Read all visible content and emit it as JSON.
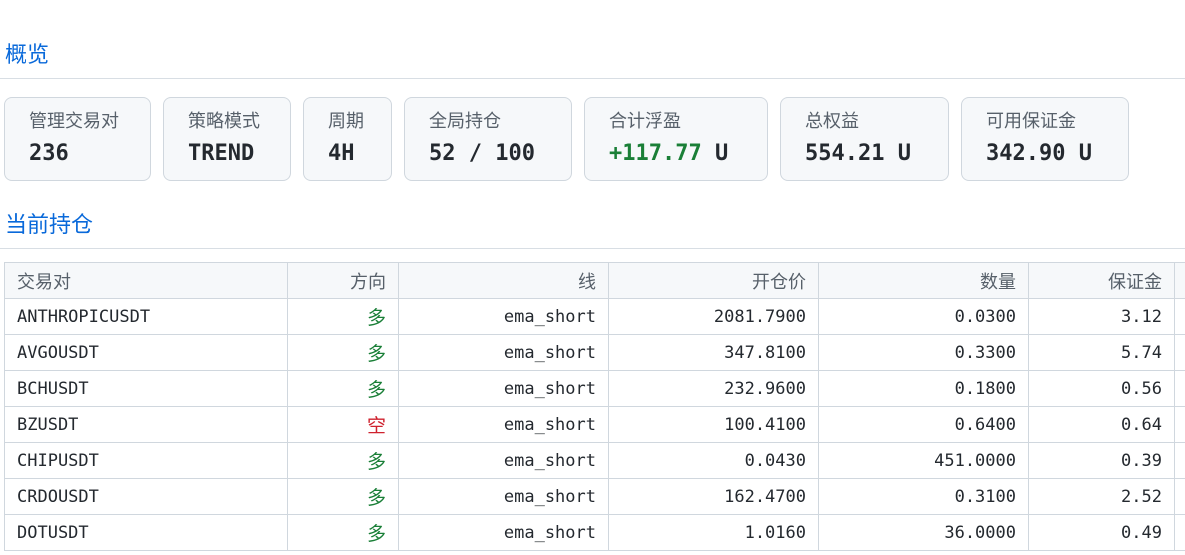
{
  "overview": {
    "title": "概览",
    "cards": [
      {
        "label": "管理交易对",
        "value": "236"
      },
      {
        "label": "策略模式",
        "value": "TREND"
      },
      {
        "label": "周期",
        "value": "4H"
      },
      {
        "label": "全局持仓",
        "value": "52 / 100"
      },
      {
        "label": "合计浮盈",
        "value": "+117.77",
        "unit": " U"
      },
      {
        "label": "总权益",
        "value": "554.21 U"
      },
      {
        "label": "可用保证金",
        "value": "342.90 U"
      }
    ],
    "colors": {
      "positive": "#1a7f37",
      "long": "#1a7f37",
      "short": "#cf222e",
      "accent": "#0969da"
    }
  },
  "positions": {
    "title": "当前持仓",
    "columns": [
      "交易对",
      "方向",
      "线",
      "开仓价",
      "数量",
      "保证金"
    ],
    "rows": [
      {
        "pair": "ANTHROPICUSDT",
        "side": "多",
        "line": "ema_short",
        "entry": "2081.7900",
        "qty": "0.0300",
        "margin": "3.12"
      },
      {
        "pair": "AVGOUSDT",
        "side": "多",
        "line": "ema_short",
        "entry": "347.8100",
        "qty": "0.3300",
        "margin": "5.74"
      },
      {
        "pair": "BCHUSDT",
        "side": "多",
        "line": "ema_short",
        "entry": "232.9600",
        "qty": "0.1800",
        "margin": "0.56"
      },
      {
        "pair": "BZUSDT",
        "side": "空",
        "line": "ema_short",
        "entry": "100.4100",
        "qty": "0.6400",
        "margin": "0.64"
      },
      {
        "pair": "CHIPUSDT",
        "side": "多",
        "line": "ema_short",
        "entry": "0.0430",
        "qty": "451.0000",
        "margin": "0.39"
      },
      {
        "pair": "CRDOUSDT",
        "side": "多",
        "line": "ema_short",
        "entry": "162.4700",
        "qty": "0.3100",
        "margin": "2.52"
      },
      {
        "pair": "DOTUSDT",
        "side": "多",
        "line": "ema_short",
        "entry": "1.0160",
        "qty": "36.0000",
        "margin": "0.49"
      }
    ]
  }
}
